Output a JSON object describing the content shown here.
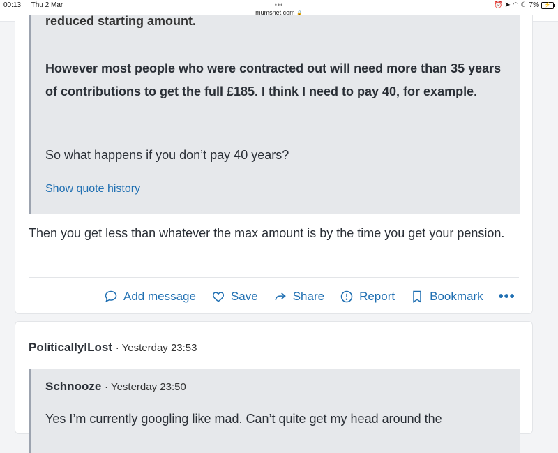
{
  "status_bar": {
    "time": "00:13",
    "date": "Thu 2 Mar",
    "url": "mumsnet.com",
    "battery": "7%"
  },
  "post1": {
    "quote_top_partial": "reduced starting amount.",
    "quote_bold": "However most people who were contracted out will need more than 35 years of contributions to get the full £185. I think I need to pay 40, for example.",
    "quote_normal": "So what happens if you don’t pay 40 years?",
    "show_quote_history": "Show quote history",
    "reply": "Then you get less than whatever the max amount is by the time you get your pension.",
    "actions": {
      "add_message": "Add message",
      "save": "Save",
      "share": "Share",
      "report": "Report",
      "bookmark": "Bookmark"
    }
  },
  "post2": {
    "author": "PoliticallyILost",
    "timestamp": "Yesterday 23:53",
    "quote": {
      "author": "Schnooze",
      "timestamp": "Yesterday 23:50",
      "text_partial": "Yes I’m currently googling like mad. Can’t quite get my head around the"
    }
  },
  "colors": {
    "link": "#1f6fb2",
    "quote_bg": "#e6e8eb",
    "quote_border": "#9ca3af"
  }
}
